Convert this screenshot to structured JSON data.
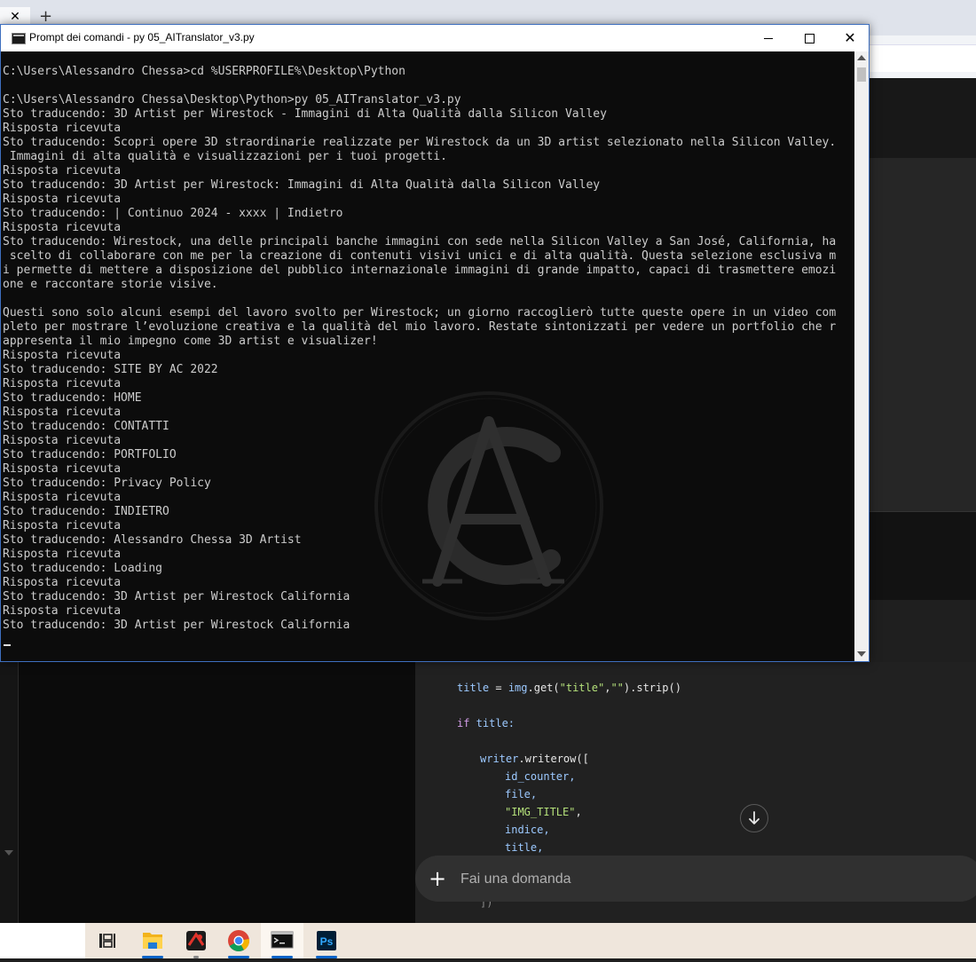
{
  "window": {
    "title": "Prompt dei comandi - py  05_AITranslator_v3.py",
    "close_glyph": "✕",
    "minimize_icon": "minimize-icon",
    "maximize_icon": "maximize-icon"
  },
  "browser": {
    "tab_close_glyph": "✕",
    "new_tab_glyph": "+"
  },
  "console": {
    "lines": [
      "C:\\Users\\Alessandro Chessa>cd %USERPROFILE%\\Desktop\\Python",
      "",
      "C:\\Users\\Alessandro Chessa\\Desktop\\Python>py 05_AITranslator_v3.py",
      "Sto traducendo: 3D Artist per Wirestock - Immagini di Alta Qualità dalla Silicon Valley",
      "Risposta ricevuta",
      "Sto traducendo: Scopri opere 3D straordinarie realizzate per Wirestock da un 3D artist selezionato nella Silicon Valley.",
      " Immagini di alta qualità e visualizzazioni per i tuoi progetti.",
      "Risposta ricevuta",
      "Sto traducendo: 3D Artist per Wirestock: Immagini di Alta Qualità dalla Silicon Valley",
      "Risposta ricevuta",
      "Sto traducendo: | Continuo 2024 - xxxx | Indietro",
      "Risposta ricevuta",
      "Sto traducendo: Wirestock, una delle principali banche immagini con sede nella Silicon Valley a San José, California, ha",
      " scelto di collaborare con me per la creazione di contenuti visivi unici e di alta qualità. Questa selezione esclusiva m",
      "i permette di mettere a disposizione del pubblico internazionale immagini di grande impatto, capaci di trasmettere emozi",
      "one e raccontare storie visive.",
      "",
      "Questi sono solo alcuni esempi del lavoro svolto per Wirestock; un giorno raccoglierò tutte queste opere in un video com",
      "pleto per mostrare l’evoluzione creativa e la qualità del mio lavoro. Restate sintonizzati per vedere un portfolio che r",
      "appresenta il mio impegno come 3D artist e visualizer!",
      "Risposta ricevuta",
      "Sto traducendo: SITE BY AC 2022",
      "Risposta ricevuta",
      "Sto traducendo: HOME",
      "Risposta ricevuta",
      "Sto traducendo: CONTATTI",
      "Risposta ricevuta",
      "Sto traducendo: PORTFOLIO",
      "Risposta ricevuta",
      "Sto traducendo: Privacy Policy",
      "Risposta ricevuta",
      "Sto traducendo: INDIETRO",
      "Risposta ricevuta",
      "Sto traducendo: Alessandro Chessa 3D Artist",
      "Risposta ricevuta",
      "Sto traducendo: Loading",
      "Risposta ricevuta",
      "Sto traducendo: 3D Artist per Wirestock California",
      "Risposta ricevuta",
      "Sto traducendo: 3D Artist per Wirestock California"
    ]
  },
  "code": {
    "l1_var": "title",
    "l1_eq": " = ",
    "l1_obj": "img",
    "l1_get": ".get(",
    "l1_s1": "\"title\"",
    "l1_comma": ",",
    "l1_s2": "\"\"",
    "l1_strip": ").strip()",
    "l2_if": "if",
    "l2_rest": " title:",
    "l3_obj": "writer",
    "l3_call": ".writerow([",
    "l4": "id_counter,",
    "l5": "file,",
    "l6_str": "\"IMG_TITLE\"",
    "l6_comma": ",",
    "l7": "indice,",
    "l8": "title,",
    "l9": "])"
  },
  "composer": {
    "placeholder": "Fai una domanda",
    "plus": "+"
  },
  "taskbar": {
    "items": [
      "task-view-icon",
      "file-explorer-icon",
      "app-icon",
      "chrome-icon",
      "terminal-icon",
      "photoshop-icon"
    ],
    "photoshop_label": "Ps"
  },
  "colors": {
    "console_bg": "#0c0c0c",
    "console_text": "#cccccc",
    "accent_blue": "#0a64c8",
    "chat_panel": "#212121"
  }
}
